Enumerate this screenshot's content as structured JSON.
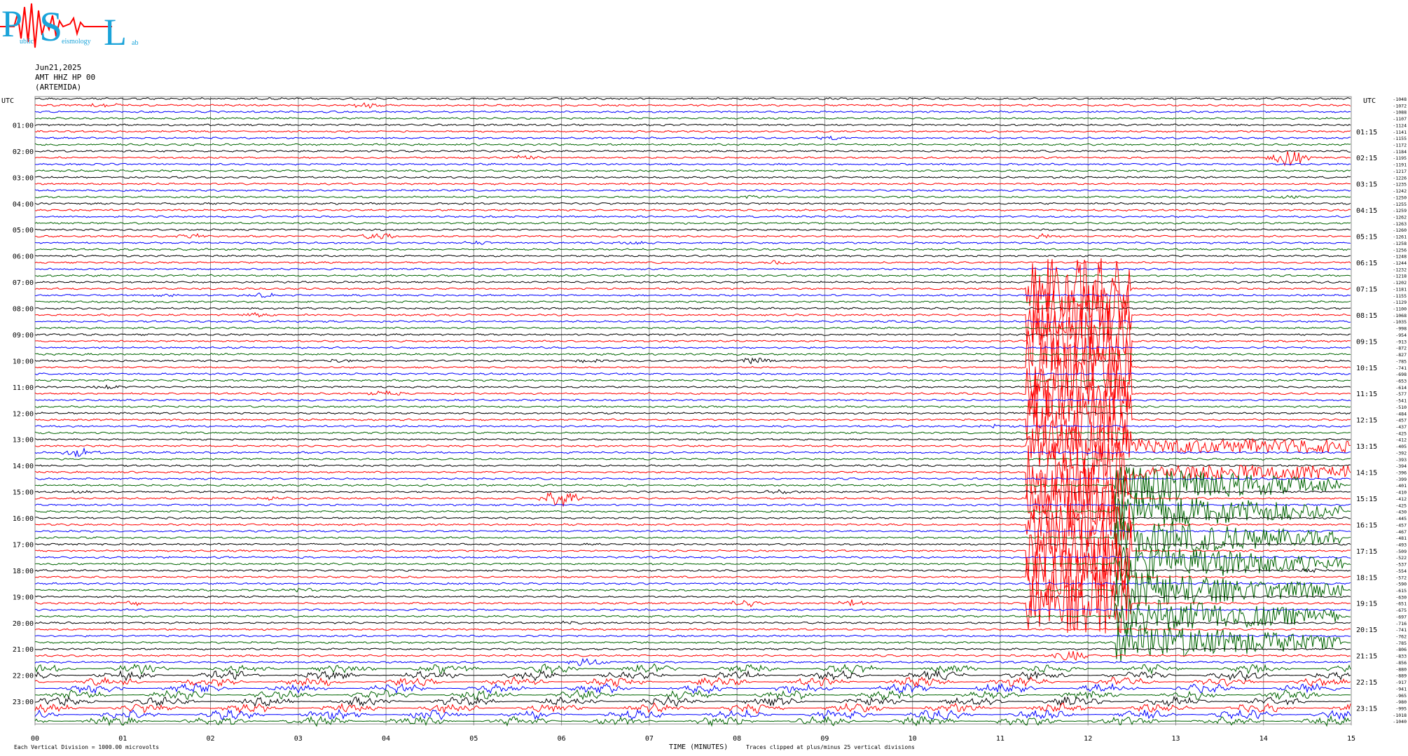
{
  "logo": {
    "big_letters": [
      "P",
      "S",
      "L"
    ],
    "small_text": [
      "ublic",
      "eismology",
      "ab"
    ]
  },
  "header": {
    "date": "Jun21,2025",
    "station": "AMT HHZ HP 00",
    "location": "(ARTEMIDA)"
  },
  "footer": {
    "scale_note": "Each Vertical Division = 1000.00 microvolts",
    "time_label": "TIME (MINUTES)",
    "clip_note": "Traces clipped at plus/minus 25 vertical divisions"
  },
  "colors": {
    "trace": [
      "#000000",
      "#ff0000",
      "#0000ff",
      "#006400"
    ],
    "grid": "#8c8c8c",
    "logo_blue": "#1aa3d9",
    "logo_red": "#ff0000"
  },
  "chart_data": {
    "type": "line",
    "description_type": "helicorder",
    "trace_count": 96,
    "minutes_per_trace": 15,
    "color_cycle": [
      "black",
      "red",
      "blue",
      "green"
    ],
    "x_ticks": [
      "00",
      "01",
      "02",
      "03",
      "04",
      "05",
      "06",
      "07",
      "08",
      "09",
      "10",
      "11",
      "12",
      "13",
      "14",
      "15"
    ],
    "xlim": [
      0,
      15
    ],
    "left_axis_label": "UTC",
    "right_axis_label": "UTC",
    "left_hour_labels": [
      "01:00",
      "02:00",
      "03:00",
      "04:00",
      "05:00",
      "06:00",
      "07:00",
      "08:00",
      "09:00",
      "10:00",
      "11:00",
      "12:00",
      "13:00",
      "14:00",
      "15:00",
      "16:00",
      "17:00",
      "18:00",
      "19:00",
      "20:00",
      "21:00",
      "22:00",
      "23:00"
    ],
    "right_hour_labels": [
      "01:15",
      "02:15",
      "03:15",
      "04:15",
      "05:15",
      "06:15",
      "07:15",
      "08:15",
      "09:15",
      "10:15",
      "11:15",
      "12:15",
      "13:15",
      "14:15",
      "15:15",
      "16:15",
      "17:15",
      "18:15",
      "19:15",
      "20:15",
      "21:15",
      "22:15",
      "23:15"
    ],
    "right_offsets": [
      "-1048",
      "-1072",
      "-1088",
      "-1107",
      "-1124",
      "-1141",
      "-1155",
      "-1172",
      "-1184",
      "-1195",
      "-1191",
      "-1217",
      "-1226",
      "-1235",
      "-1242",
      "-1250",
      "-1255",
      "-1259",
      "-1262",
      "-1263",
      "-1260",
      "-1261",
      "-1258",
      "-1256",
      "-1248",
      "-1244",
      "-1232",
      "-1218",
      "-1202",
      "-1181",
      "-1155",
      "-1129",
      "-1100",
      "-1068",
      "-1035",
      "-998",
      "-954",
      "-913",
      "-872",
      "-827",
      "-785",
      "-741",
      "-698",
      "-653",
      "-614",
      "-577",
      "-541",
      "-510",
      "-484",
      "-457",
      "-437",
      "-425",
      "-412",
      "-405",
      "-392",
      "-393",
      "-394",
      "-396",
      "-399",
      "-401",
      "-410",
      "-412",
      "-425",
      "-430",
      "-445",
      "-457",
      "-467",
      "-481",
      "-493",
      "-509",
      "-522",
      "-537",
      "-554",
      "-572",
      "-590",
      "-615",
      "-630",
      "-651",
      "-675",
      "-697",
      "-716",
      "-741",
      "-762",
      "-785",
      "-806",
      "-833",
      "-856",
      "-880",
      "-889",
      "-917",
      "-941",
      "-965",
      "-980",
      "-995",
      "-1018",
      "-1040"
    ],
    "events": [
      {
        "trace": 1,
        "minute": 0.8,
        "amplitude": 1.5
      },
      {
        "trace": 1,
        "minute": 3.8,
        "amplitude": 1.5
      },
      {
        "trace": 6,
        "minute": 9.1,
        "amplitude": 1.5
      },
      {
        "trace": 9,
        "minute": 5.6,
        "amplitude": 1.8
      },
      {
        "trace": 9,
        "minute": 14.3,
        "amplitude": 6
      },
      {
        "trace": 15,
        "minute": 8.2,
        "amplitude": 1.5
      },
      {
        "trace": 15,
        "minute": 14.3,
        "amplitude": 1.5
      },
      {
        "trace": 21,
        "minute": 1.8,
        "amplitude": 1.5
      },
      {
        "trace": 21,
        "minute": 3.9,
        "amplitude": 2
      },
      {
        "trace": 21,
        "minute": 11.5,
        "amplitude": 1.5
      },
      {
        "trace": 22,
        "minute": 5.1,
        "amplitude": 2
      },
      {
        "trace": 22,
        "minute": 6.8,
        "amplitude": 1.5
      },
      {
        "trace": 25,
        "minute": 8.5,
        "amplitude": 1.5
      },
      {
        "trace": 30,
        "minute": 1.5,
        "amplitude": 1.5
      },
      {
        "trace": 30,
        "minute": 2.6,
        "amplitude": 2
      },
      {
        "trace": 33,
        "minute": 2.5,
        "amplitude": 1.5
      },
      {
        "trace": 40,
        "minute": 3.5,
        "amplitude": 1.5
      },
      {
        "trace": 40,
        "minute": 6.3,
        "amplitude": 2
      },
      {
        "trace": 40,
        "minute": 8.2,
        "amplitude": 3
      },
      {
        "trace": 44,
        "minute": 0.8,
        "amplitude": 2
      },
      {
        "trace": 45,
        "minute": 4,
        "amplitude": 1.5
      },
      {
        "trace": 50,
        "minute": 10.9,
        "amplitude": 1.5
      },
      {
        "trace": 54,
        "minute": 0.5,
        "amplitude": 4
      },
      {
        "trace": 60,
        "minute": 0.5,
        "amplitude": 1.5
      },
      {
        "trace": 60,
        "minute": 8.5,
        "amplitude": 1.5
      },
      {
        "trace": 61,
        "minute": 6,
        "amplitude": 8
      },
      {
        "trace": 61,
        "minute": 2.7,
        "amplitude": 1.5
      },
      {
        "trace": 72,
        "minute": 14.5,
        "amplitude": 2
      },
      {
        "trace": 75,
        "minute": 3,
        "amplitude": 2
      },
      {
        "trace": 77,
        "minute": 1.1,
        "amplitude": 1.5
      },
      {
        "trace": 77,
        "minute": 8.1,
        "amplitude": 2.5
      },
      {
        "trace": 77,
        "minute": 9.3,
        "amplitude": 2
      },
      {
        "trace": 80,
        "minute": 6.1,
        "amplitude": 1.5
      },
      {
        "trace": 86,
        "minute": 6.3,
        "amplitude": 4
      },
      {
        "trace": 85,
        "minute": 11.8,
        "amplitude": 4
      }
    ],
    "large_event": {
      "start_trace": 28,
      "start_minute": 11.3,
      "clipped_region_minutes": [
        11.3,
        12.5
      ],
      "clipped_region_traces": [
        28,
        77
      ],
      "green_burst": {
        "traces": [
          56,
          84
        ],
        "minutes": [
          12.3,
          14.9
        ]
      },
      "red_coda": {
        "traces": [
          53,
          57
        ],
        "minutes": [
          12.5,
          15
        ]
      }
    },
    "noisy_low_traces": [
      87,
      95
    ]
  }
}
